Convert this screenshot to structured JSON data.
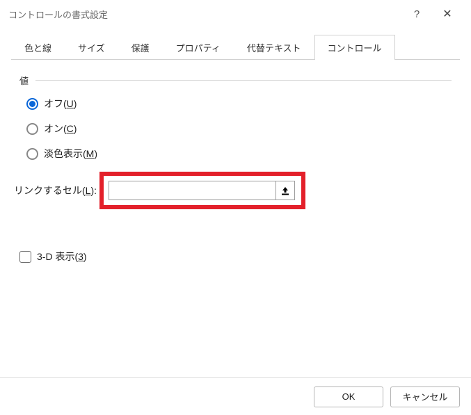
{
  "title": "コントロールの書式設定",
  "tabs": [
    "色と線",
    "サイズ",
    "保護",
    "プロパティ",
    "代替テキスト",
    "コントロール"
  ],
  "activeTab": 5,
  "group": {
    "header": "値"
  },
  "radios": {
    "off": {
      "pre": "オフ(",
      "u": "U",
      "post": ")"
    },
    "on": {
      "pre": "オン(",
      "u": "C",
      "post": ")"
    },
    "mixed": {
      "pre": "淡色表示(",
      "u": "M",
      "post": ")"
    }
  },
  "linkcell": {
    "pre": "リンクするセル(",
    "u": "L",
    "post": "):",
    "value": ""
  },
  "threed": {
    "pre": "3-D 表示(",
    "u": "3",
    "post": ")"
  },
  "buttons": {
    "ok": "OK",
    "cancel": "キャンセル"
  }
}
